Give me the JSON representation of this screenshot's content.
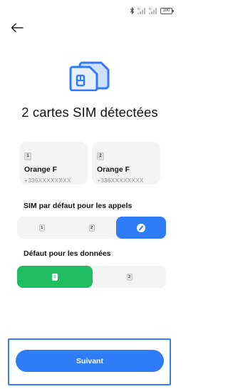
{
  "status_bar": {
    "battery_level": "100",
    "icons": [
      "bluetooth-icon",
      "signal-icon",
      "signal-icon",
      "battery-icon"
    ]
  },
  "header": {
    "back_icon": "arrow-left-icon"
  },
  "hero": {
    "icon": "dual-sim-icon",
    "accent_color": "#2f7cf6"
  },
  "title": "2 cartes SIM détectées",
  "sims": [
    {
      "slot": "1",
      "carrier": "Orange F",
      "number": "+336XXXXXXXX"
    },
    {
      "slot": "2",
      "carrier": "Orange F",
      "number": "+336XXXXXXXX"
    }
  ],
  "calls": {
    "label": "SIM par défaut pour les appels",
    "options": [
      {
        "slot": "1",
        "selected": false
      },
      {
        "slot": "2",
        "selected": false
      },
      {
        "icon": "ask-every-time-icon",
        "selected": true
      }
    ],
    "active_color": "#2f7cf6"
  },
  "data": {
    "label": "Défaut pour les données",
    "options": [
      {
        "slot": "1",
        "selected": true
      },
      {
        "slot": "2",
        "selected": false
      }
    ],
    "active_color": "#1fbc61"
  },
  "footer": {
    "next_label": "Suivant",
    "button_color": "#2f7cf6"
  }
}
